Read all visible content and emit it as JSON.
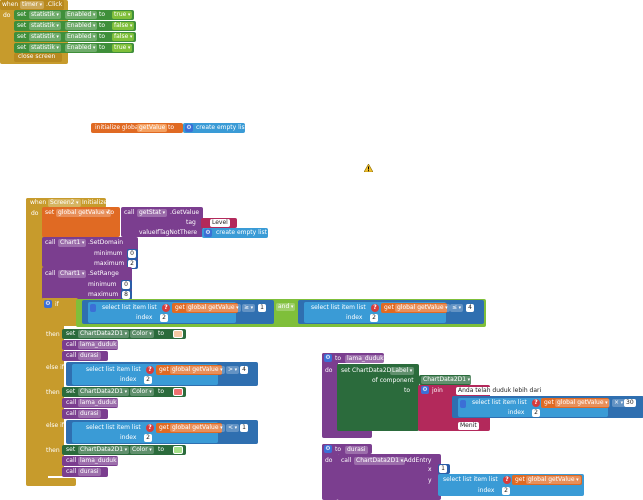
{
  "timer_handler": {
    "when": "when",
    "component": "timer",
    "event": ".Click",
    "do": "do",
    "sets": [
      {
        "set": "set",
        "component": "statistik",
        "property": "Enabled",
        "to": "to",
        "value": "true"
      },
      {
        "set": "set",
        "component": "statistik",
        "property": "Enabled",
        "to": "to",
        "value": "false"
      },
      {
        "set": "set",
        "component": "statistik",
        "property": "Enabled",
        "to": "to",
        "value": "false"
      },
      {
        "set": "set",
        "component": "statistik",
        "property": "Enabled",
        "to": "to",
        "value": "true"
      }
    ],
    "close": "close screen"
  },
  "global_init": {
    "label": "initialize global",
    "name": "getValue",
    "to": "to",
    "value": "create empty list"
  },
  "warning_icon": "warning-icon",
  "screen_init": {
    "when": "when",
    "component": "Screen2",
    "event": "Initialize",
    "do": "do",
    "set": "set",
    "var": "global getValue",
    "to": "to",
    "call": "call",
    "call_comp": "getStat",
    "call_method": ".GetValue",
    "tag_label": "tag",
    "tag_value": "Level",
    "vitn_label": "valueIfTagNotThere",
    "vitn_value": "create empty list",
    "domain": {
      "call": "call",
      "comp": "Chart1",
      "method": ".SetDomain",
      "min_label": "minimum",
      "min": "0",
      "max_label": "maximum",
      "max": "2"
    },
    "range": {
      "call": "call",
      "comp": "Chart1",
      "method": ".SetRange",
      "min_label": "minimum",
      "min": "0",
      "max_label": "maximum",
      "max": "8"
    },
    "if": {
      "label": "if",
      "sli": "select list item  list",
      "get": "get",
      "var": "global getValue",
      "op": "≥",
      "num": "1",
      "index": "index",
      "idx": "2",
      "and": "and",
      "op2": "≤",
      "num2": "4"
    },
    "then": "then",
    "elseif": "else if",
    "branches": [
      {
        "set": "set",
        "comp": "ChartData2D1",
        "prop": "Color",
        "to": "to",
        "color": "#f6c8a4",
        "call1": "lama_duduk",
        "call2": "durasi",
        "call": "call"
      },
      {
        "set": "set",
        "comp": "ChartData2D1",
        "prop": "Color",
        "to": "to",
        "color": "#f07070",
        "call1": "lama_duduk",
        "call2": "durasi",
        "call": "call"
      },
      {
        "set": "set",
        "comp": "ChartData2D1",
        "prop": "Color",
        "to": "to",
        "color": "#a6e28a",
        "call1": "lama_duduk",
        "call2": "durasi",
        "call": "call"
      }
    ],
    "elseif1": {
      "sli": "select list item  list",
      "get": "get",
      "var": "global getValue",
      "op": ">",
      "num": "4",
      "index": "index",
      "idx": "2"
    },
    "elseif2": {
      "sli": "select list item  list",
      "get": "get",
      "var": "global getValue",
      "op": "<",
      "num": "1",
      "index": "index",
      "idx": "2"
    }
  },
  "lama_duduk_proc": {
    "to": "to",
    "name": "lama_duduk",
    "do": "do",
    "set": "set",
    "comp": "ChartData2D",
    "prop": "Label",
    "of_component": "of component",
    "comp_value": "ChartData2D1",
    "to2": "to",
    "join": "join",
    "text1": "Anda telah duduk lebih dari",
    "sli": "select list item  list",
    "get": "get",
    "var": "global getValue",
    "op": "×",
    "num": "30",
    "index": "index",
    "idx": "2",
    "text2": "Menit"
  },
  "durasi_proc": {
    "to": "to",
    "name": "durasi",
    "do": "do",
    "call": "call",
    "comp": "ChartData2D1",
    "method": ".AddEntry",
    "x_label": "x",
    "x": "1",
    "y_label": "y",
    "sli": "select list item  list",
    "get": "get",
    "var": "global getValue",
    "index": "index",
    "idx": "2"
  }
}
